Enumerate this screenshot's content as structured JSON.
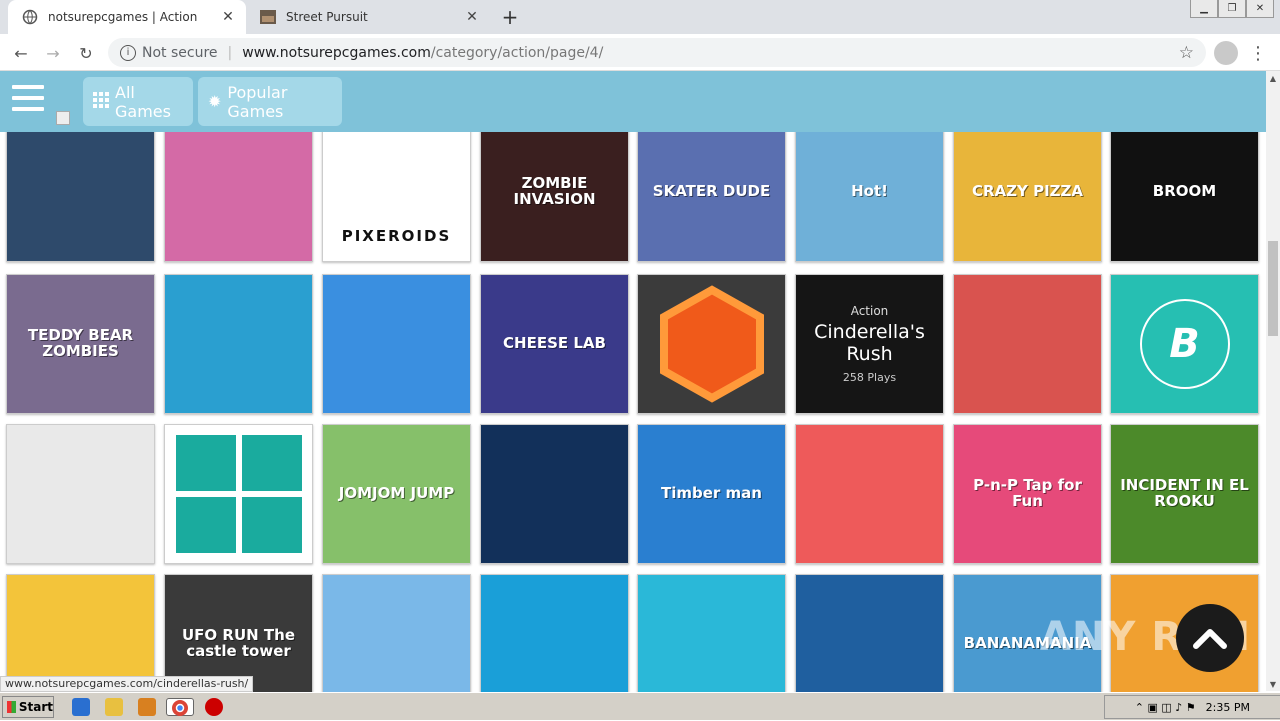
{
  "browser": {
    "tabs": [
      {
        "title": "notsurepcgames | Action",
        "active": true
      },
      {
        "title": "Street Pursuit",
        "active": false
      }
    ],
    "security_label": "Not secure",
    "url_host": "www.notsurepcgames.com",
    "url_path": "/category/action/page/4/",
    "status_url": "www.notsurepcgames.com/cinderellas-rush/"
  },
  "site": {
    "nav": {
      "all_games": "All Games",
      "popular_games": "Popular Games"
    },
    "hovered_game": {
      "category": "Action",
      "title": "Cinderella's Rush",
      "plays": "258 Plays"
    },
    "tiles": [
      {
        "label": "",
        "color": "#2e4a6b"
      },
      {
        "label": "",
        "color": "#d46aa6"
      },
      {
        "label": "PIXEROIDS",
        "color": "#ffffff"
      },
      {
        "label": "ZOMBIE INVASION",
        "color": "#3a1f1f"
      },
      {
        "label": "SKATER DUDE",
        "color": "#5a6fb0"
      },
      {
        "label": "Hot!",
        "color": "#6fb0d8"
      },
      {
        "label": "CRAZY PIZZA",
        "color": "#e8b53a"
      },
      {
        "label": "BROOM",
        "color": "#111111"
      },
      {
        "label": "TEDDY BEAR ZOMBIES",
        "color": "#7a6b8f"
      },
      {
        "label": "",
        "color": "#2a9fd0"
      },
      {
        "label": "",
        "color": "#3a8fe0"
      },
      {
        "label": "CHEESE LAB",
        "color": "#3a3a8a"
      },
      {
        "label": "",
        "color": "#3b3b3b"
      },
      {
        "label": "",
        "color": "#151515"
      },
      {
        "label": "",
        "color": "#d9534f"
      },
      {
        "label": "",
        "color": "#26bfb2"
      },
      {
        "label": "",
        "color": "#e9e9e9"
      },
      {
        "label": "",
        "color": "#1aab9e"
      },
      {
        "label": "JOMJOM JUMP",
        "color": "#86c06a"
      },
      {
        "label": "",
        "color": "#12305a"
      },
      {
        "label": "Timber man",
        "color": "#2a7fd0"
      },
      {
        "label": "",
        "color": "#ee5a5a"
      },
      {
        "label": "P-n-P Tap for Fun",
        "color": "#e64a7a"
      },
      {
        "label": "INCIDENT IN EL ROOKU",
        "color": "#4c8a2a"
      },
      {
        "label": "",
        "color": "#f3c43a"
      },
      {
        "label": "UFO RUN The castle tower",
        "color": "#3a3a3a"
      },
      {
        "label": "",
        "color": "#7ab8e8"
      },
      {
        "label": "",
        "color": "#1a9fd8"
      },
      {
        "label": "",
        "color": "#2ab8d8"
      },
      {
        "label": "",
        "color": "#1f5f9f"
      },
      {
        "label": "BANANAMANIA",
        "color": "#4a9ad0"
      },
      {
        "label": "",
        "color": "#f0a030"
      }
    ]
  },
  "taskbar": {
    "start_label": "Start",
    "clock": "2:35 PM"
  },
  "watermark": "ANY RUN"
}
